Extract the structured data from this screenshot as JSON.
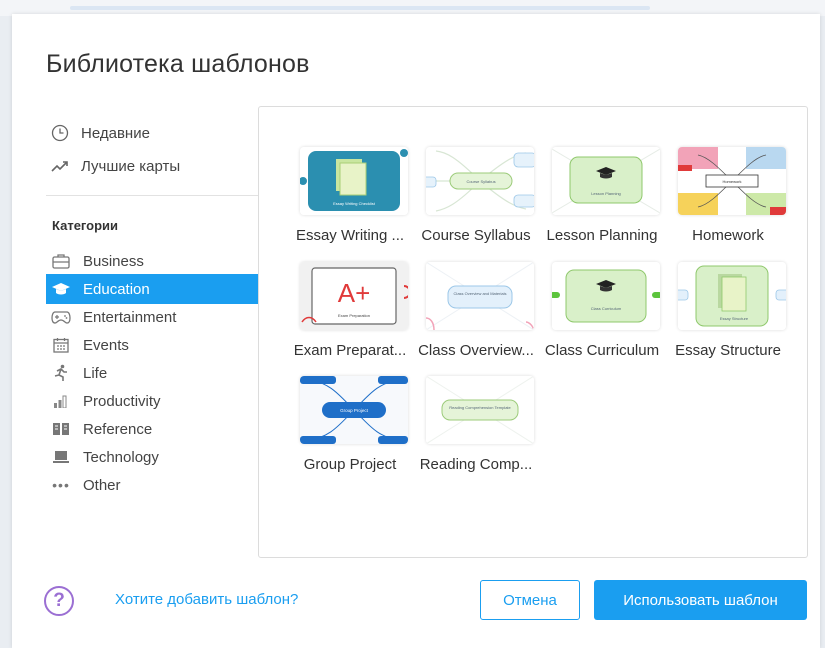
{
  "dialog": {
    "title": "Библиотека шаблонов",
    "help_link": "Хотите добавить шаблон?",
    "cancel_label": "Отмена",
    "use_label": "Использовать шаблон"
  },
  "sidebar": {
    "quick": [
      {
        "label": "Недавние",
        "icon": "clock-icon"
      },
      {
        "label": "Лучшие карты",
        "icon": "trending-icon"
      }
    ],
    "categories_heading": "Категории",
    "categories": [
      {
        "label": "Business",
        "icon": "briefcase-icon"
      },
      {
        "label": "Education",
        "icon": "graduation-cap-icon",
        "selected": true
      },
      {
        "label": "Entertainment",
        "icon": "gamepad-icon"
      },
      {
        "label": "Events",
        "icon": "calendar-icon"
      },
      {
        "label": "Life",
        "icon": "running-person-icon"
      },
      {
        "label": "Productivity",
        "icon": "bar-chart-icon"
      },
      {
        "label": "Reference",
        "icon": "book-icon"
      },
      {
        "label": "Technology",
        "icon": "laptop-icon"
      },
      {
        "label": "Other",
        "icon": "more-icon"
      }
    ]
  },
  "templates": [
    {
      "label": "Essay Writing ...",
      "thumb_text": "Essay Writing Checklist"
    },
    {
      "label": "Course Syllabus",
      "thumb_text": "Course Syllabus"
    },
    {
      "label": "Lesson Planning",
      "thumb_text": "Lesson Planning"
    },
    {
      "label": "Homework",
      "thumb_text": "Homework"
    },
    {
      "label": "Exam Preparat...",
      "thumb_text": "Exam Preparation",
      "thumb_big": "A+"
    },
    {
      "label": "Class Overview...",
      "thumb_text": "Class Overview and Materials"
    },
    {
      "label": "Class Curriculum",
      "thumb_text": "Class Curriculum"
    },
    {
      "label": "Essay Structure",
      "thumb_text": "Essay Structure"
    },
    {
      "label": "Group Project",
      "thumb_text": "Group Project"
    },
    {
      "label": "Reading Comp...",
      "thumb_text": "Reading Comprehension Template"
    }
  ],
  "colors": {
    "accent": "#1a9ef0",
    "help": "#9b6fd3"
  }
}
